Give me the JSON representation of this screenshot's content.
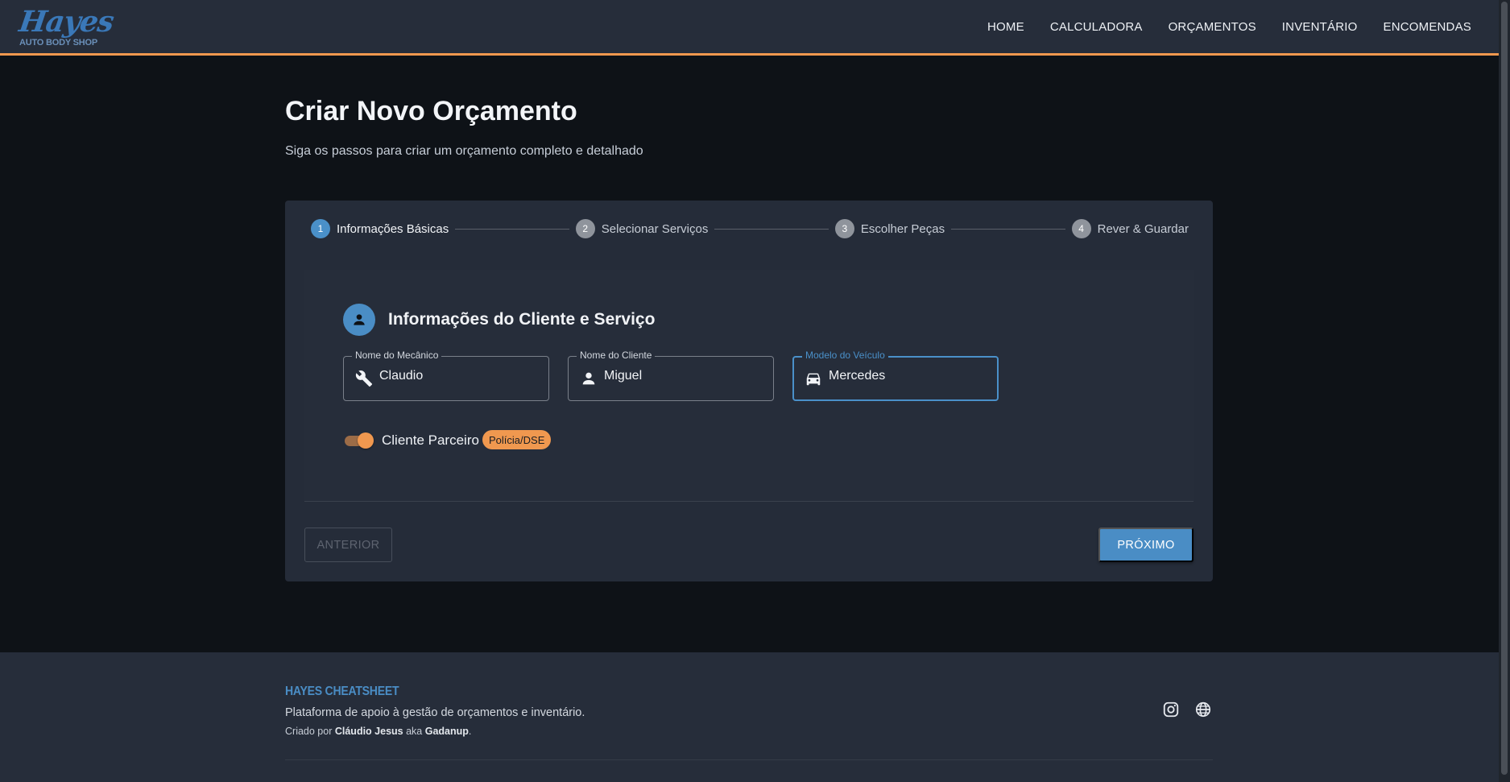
{
  "header": {
    "logo_script": "Hayes",
    "logo_sub": "AUTO BODY SHOP",
    "nav": [
      "HOME",
      "CALCULADORA",
      "ORÇAMENTOS",
      "INVENTÁRIO",
      "ENCOMENDAS"
    ]
  },
  "page": {
    "title": "Criar Novo Orçamento",
    "subtitle": "Siga os passos para criar um orçamento completo e detalhado"
  },
  "stepper": {
    "active_step": 1,
    "steps": [
      {
        "number": "1",
        "label": "Informações Básicas"
      },
      {
        "number": "2",
        "label": "Selecionar Serviços"
      },
      {
        "number": "3",
        "label": "Escolher Peças"
      },
      {
        "number": "4",
        "label": "Rever & Guardar"
      }
    ]
  },
  "form": {
    "section_title": "Informações do Cliente e Serviço",
    "section_icon": "person-icon",
    "mechanic": {
      "label": "Nome do Mecânico",
      "value": "Claudio",
      "icon": "wrench-icon"
    },
    "client": {
      "label": "Nome do Cliente",
      "value": "Miguel",
      "icon": "person-icon"
    },
    "vehicle": {
      "label": "Modelo do Veículo",
      "value": "Mercedes",
      "icon": "car-icon",
      "focused": true
    },
    "partner_toggle": {
      "label": "Cliente Parceiro",
      "on": true,
      "badge": "Polícia/DSE"
    }
  },
  "actions": {
    "prev_label": "ANTERIOR",
    "next_label": "PRÓXIMO"
  },
  "footer": {
    "brand": "HAYES CHEATSHEET",
    "description": "Plataforma de apoio à gestão de orçamentos e inventário.",
    "credit_prefix": "Criado por",
    "credit_author": "Cláudio Jesus",
    "credit_aka": "aka",
    "credit_alias": "Gadanup",
    "credit_suffix": ".",
    "icons": [
      "instagram-icon",
      "globe-icon"
    ]
  },
  "colors": {
    "accent_orange": "#f0984f",
    "accent_blue": "#4a8dc5",
    "background": "#0e1217",
    "surface": "#252c39"
  }
}
